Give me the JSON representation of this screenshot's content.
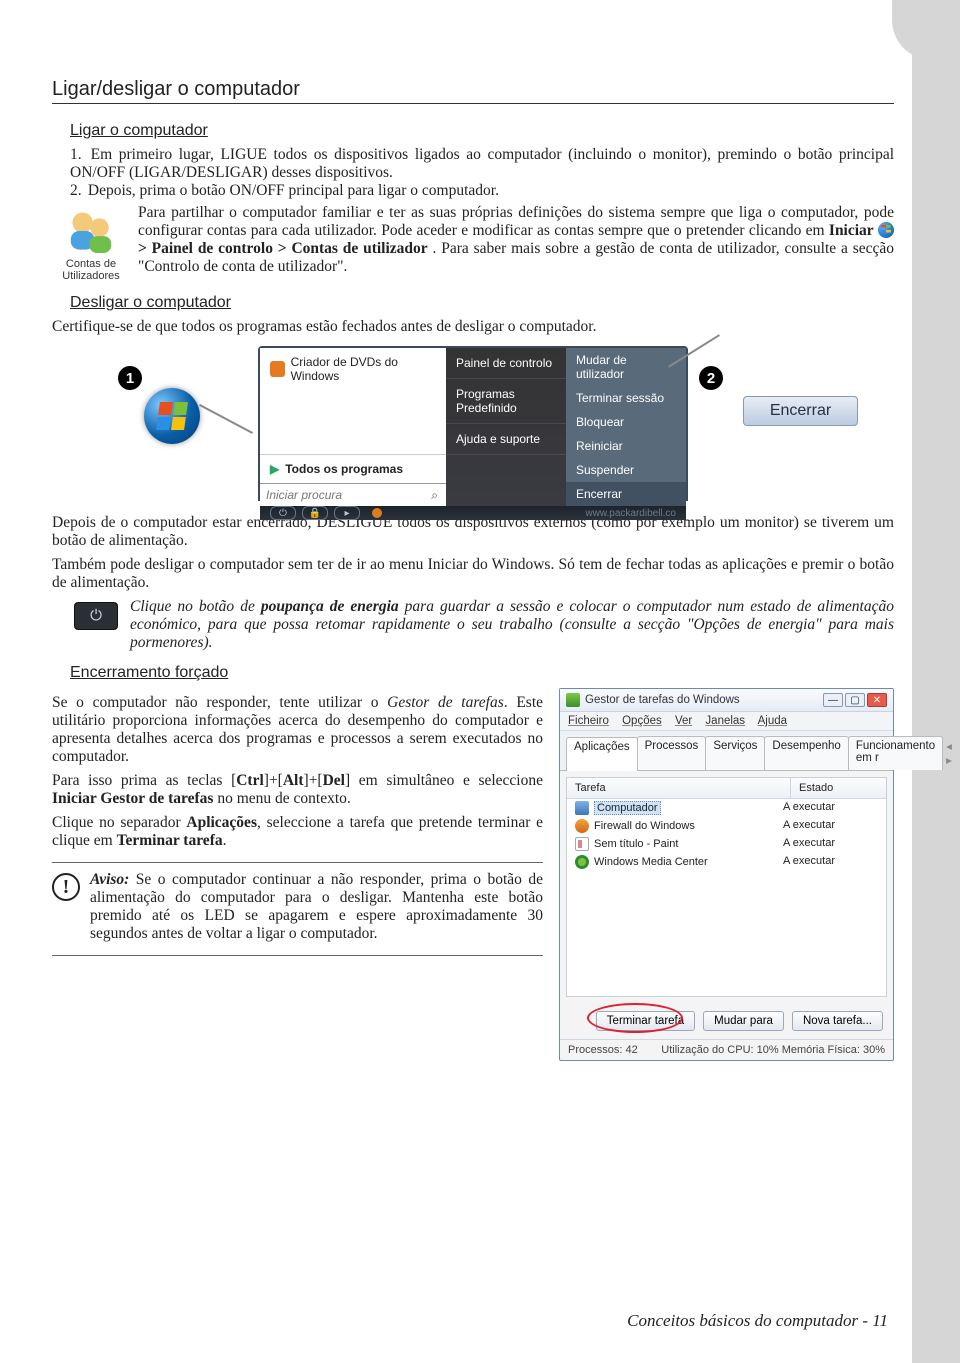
{
  "headings": {
    "main": "Ligar/desligar o computador",
    "sub1": "Ligar o computador",
    "sub2": "Desligar o computador",
    "sub3": "Encerramento forçado"
  },
  "steps": {
    "s1_num": "1.",
    "s1": "Em primeiro lugar, LIGUE todos os dispositivos ligados ao computador (incluindo o monitor), premindo o botão principal ON/OFF (LIGAR/DESLIGAR) desses dispositivos.",
    "s2_num": "2.",
    "s2": "Depois, prima o botão ON/OFF principal para ligar o computador."
  },
  "icon_label": "Contas de Utilizadores",
  "share_text": {
    "a": "Para partilhar o computador familiar e ter as suas próprias definições do sistema sempre que liga o computador, pode configurar contas para cada utilizador. Pode aceder e modificar as contas sempre que o pretender clicando em ",
    "iniciar": "Iniciar",
    "b": " > Painel de controlo > Contas de utilizador",
    "c": ". Para saber mais sobre a gestão de conta de utilizador, consulte a secção \"Controlo de conta de utilizador\"."
  },
  "closing_line": "Certifique-se de que todos os programas estão fechados antes de desligar o computador.",
  "startmenu": {
    "dvd": "Criador de DVDs do Windows",
    "all": "Todos os programas",
    "search_placeholder": "Iniciar procura",
    "mid": {
      "ctrl": "Painel de controlo",
      "defprog": "Programas Predefinido",
      "help": "Ajuda e suporte"
    },
    "right": {
      "switch": "Mudar de utilizador",
      "logoff": "Terminar sessão",
      "lock": "Bloquear",
      "restart": "Reiniciar",
      "suspend": "Suspender",
      "shutdown": "Encerrar"
    },
    "bottom_hint": "www.packardibell.co"
  },
  "badges": {
    "n1": "1",
    "n2": "2"
  },
  "callout_shutdown": "Encerrar",
  "after_shutdown": {
    "p1": "Depois de o computador estar encerrado, DESLIGUE todos os dispositivos externos (como por exemplo um monitor) se tiverem um botão de alimentação.",
    "p2": "Também pode desligar o computador sem ter de ir ao menu Iniciar do Windows. Só tem de fechar todas as aplicações e premir o botão de alimentação."
  },
  "power_note": {
    "a": "Clique no botão de ",
    "b": "poupança de energia",
    "c": " para guardar a sessão e colocar o computador num estado de alimentação económico, para que possa retomar rapidamente o seu trabalho (consulte a secção \"Opções de energia\" para mais pormenores)."
  },
  "forced": {
    "p1a": "Se o computador não responder, tente utilizar o",
    "p1b": "Gestor de tarefas",
    "p1c": ". Este utilitário proporciona informações acerca do desempenho do computador e apresenta detalhes acerca dos programas e processos a serem executados no computador.",
    "p2a": "Para isso prima as teclas [",
    "p2b": "Ctrl",
    "p2c": "]+[",
    "p2d": "Alt",
    "p2e": "]+[",
    "p2f": "Del",
    "p2g": "] em simultâneo e seleccione ",
    "p2h": "Iniciar Gestor de tarefas",
    "p2i": " no menu de contexto.",
    "p3a": "Clique no separador ",
    "p3b": "Aplicações",
    "p3c": ", seleccione a tarefa que pretende terminar e clique em ",
    "p3d": "Terminar tarefa",
    "p3e": "."
  },
  "warning": {
    "label": "Aviso:",
    "text": " Se o computador continuar a não responder, prima o botão de alimentação do computador para o desligar. Mantenha este botão premido até os LED se apagarem e espere aproximadamente 30 segundos antes de voltar a ligar o computador."
  },
  "taskmgr": {
    "title": "Gestor de tarefas do Windows",
    "menu": {
      "file": "Ficheiro",
      "options": "Opções",
      "view": "Ver",
      "windows": "Janelas",
      "help": "Ajuda"
    },
    "tabs": {
      "apps": "Aplicações",
      "proc": "Processos",
      "serv": "Serviços",
      "perf": "Desempenho",
      "net": "Funcionamento em r"
    },
    "cols": {
      "task": "Tarefa",
      "state": "Estado"
    },
    "rows": [
      {
        "icon": "ic-comp",
        "name": "Computador",
        "state": "A executar",
        "selected": true
      },
      {
        "icon": "ic-fw",
        "name": "Firewall do Windows",
        "state": "A executar"
      },
      {
        "icon": "ic-paint",
        "name": "Sem título - Paint",
        "state": "A executar"
      },
      {
        "icon": "ic-wmc",
        "name": "Windows Media Center",
        "state": "A executar"
      }
    ],
    "buttons": {
      "end": "Terminar tarefa",
      "switch": "Mudar para",
      "new": "Nova tarefa..."
    },
    "status": {
      "proc": "Processos: 42",
      "cpu": "Utilização do CPU: 10%  Memória Física: 30%"
    }
  },
  "footer": {
    "text": "Conceitos básicos do computador -",
    "page": " 11"
  }
}
